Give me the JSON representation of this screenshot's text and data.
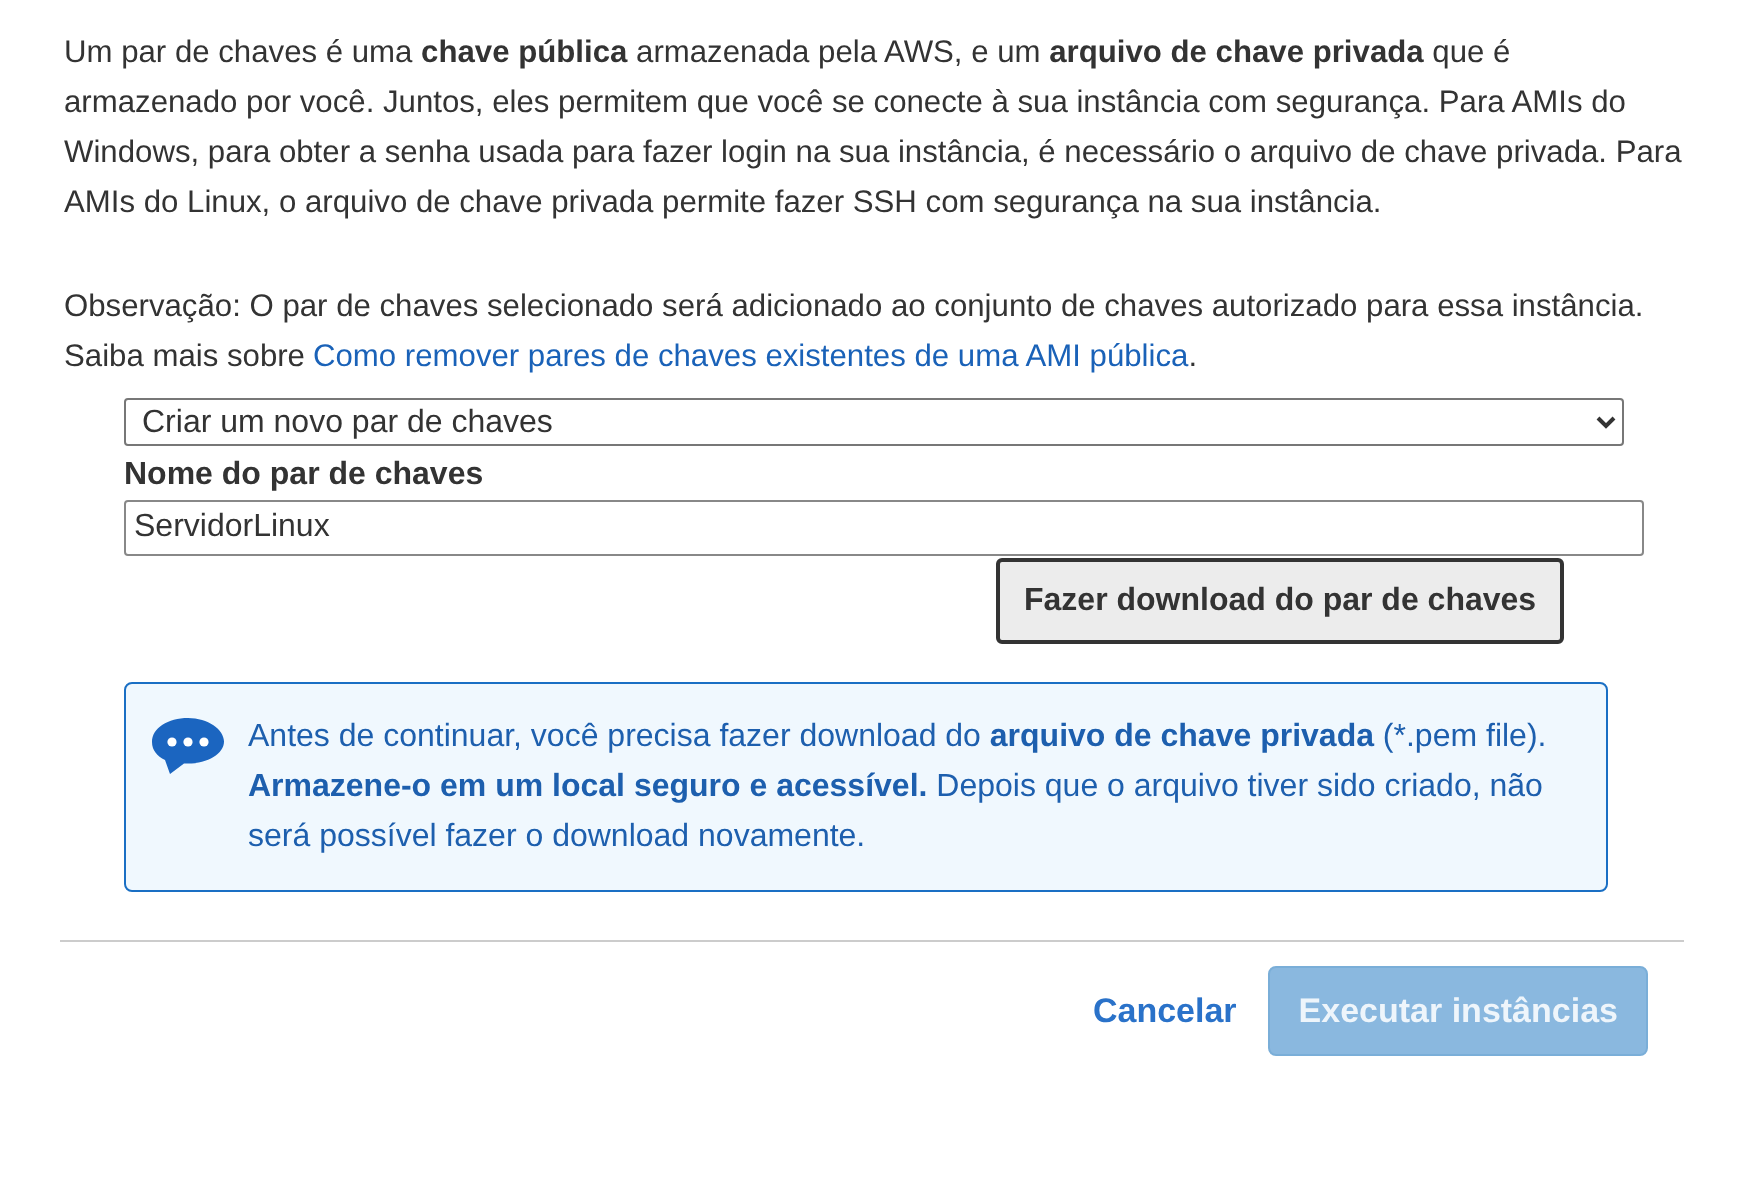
{
  "intro": "Um par de chaves é uma **chave pública** armazenada pela AWS, e um **arquivo de chave privada** que é armazenado por você. Juntos, eles permitem que você se conecte à sua instância com segurança. Para AMIs do Windows, para obter a senha usada para fazer login na sua instância, é necessário o arquivo de chave privada. Para AMIs do Linux, o arquivo de chave privada permite fazer SSH com segurança na sua instância.",
  "note": {
    "text": "Observação: O par de chaves selecionado será adicionado ao conjunto de chaves autorizado para essa instância. Saiba mais sobre",
    "link": "Como remover pares de chaves existentes de uma AMI pública",
    "after": "."
  },
  "key_pair_select": {
    "value": "Criar um novo par de chaves"
  },
  "name_field": {
    "label": "Nome do par de chaves",
    "value": "ServidorLinux"
  },
  "download_button": "Fazer download do par de chaves",
  "alert": {
    "text": "Antes de continuar, você precisa fazer download do **arquivo de chave privada** (*.pem file). **Armazene-o em um local seguro e acessível.** Depois que o arquivo tiver sido criado, não será possível fazer o download novamente."
  },
  "actions": [
    {
      "label": "Cancelar",
      "kind": "link",
      "disabled": false
    },
    {
      "label": "Executar instâncias",
      "kind": "primary",
      "disabled": true
    }
  ]
}
